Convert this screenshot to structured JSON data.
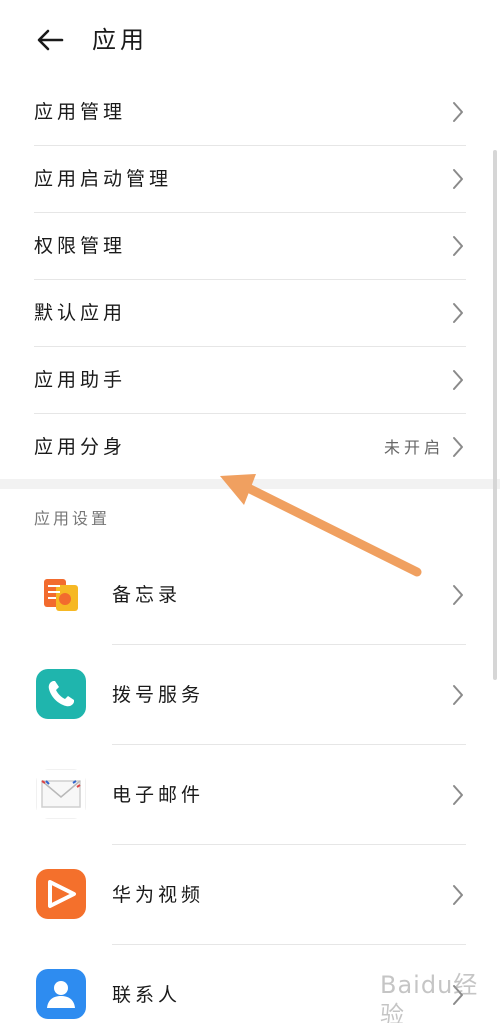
{
  "header": {
    "title": "应用"
  },
  "menu": [
    {
      "label": "应用管理",
      "value": ""
    },
    {
      "label": "应用启动管理",
      "value": ""
    },
    {
      "label": "权限管理",
      "value": ""
    },
    {
      "label": "默认应用",
      "value": ""
    },
    {
      "label": "应用助手",
      "value": ""
    },
    {
      "label": "应用分身",
      "value": "未开启"
    }
  ],
  "section": {
    "title": "应用设置"
  },
  "apps": [
    {
      "label": "备忘录",
      "icon": "notes-icon"
    },
    {
      "label": "拨号服务",
      "icon": "phone-icon"
    },
    {
      "label": "电子邮件",
      "icon": "mail-icon"
    },
    {
      "label": "华为视频",
      "icon": "video-icon"
    },
    {
      "label": "联系人",
      "icon": "contacts-icon"
    }
  ],
  "annotation": {
    "color": "#f0a060"
  },
  "watermark": "Baidu经验"
}
